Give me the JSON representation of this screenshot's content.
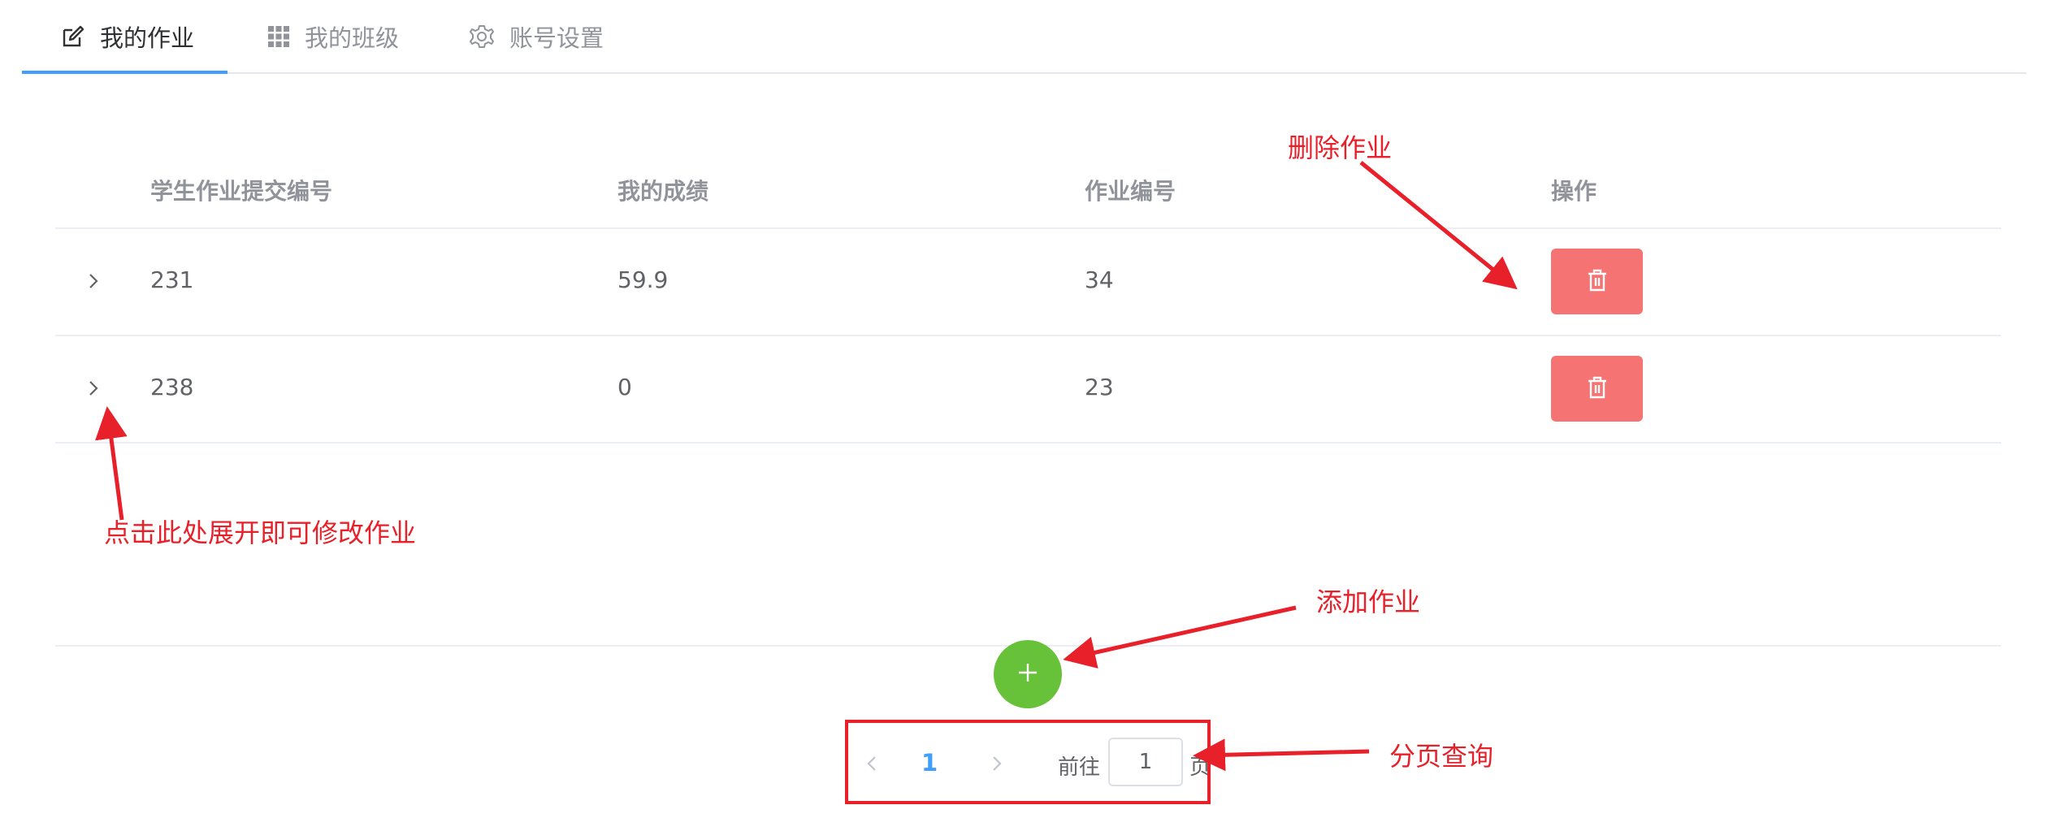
{
  "tabs": [
    {
      "label": "我的作业",
      "icon": "edit-icon",
      "active": true
    },
    {
      "label": "我的班级",
      "icon": "grid-icon",
      "active": false
    },
    {
      "label": "账号设置",
      "icon": "gear-icon",
      "active": false
    }
  ],
  "table": {
    "headers": [
      "学生作业提交编号",
      "我的成绩",
      "作业编号",
      "操作"
    ],
    "rows": [
      {
        "submission_id": "231",
        "score": "59.9",
        "assignment_id": "34"
      },
      {
        "submission_id": "238",
        "score": "0",
        "assignment_id": "23"
      }
    ]
  },
  "actions": {
    "delete_icon": "trash-icon",
    "expand_icon": "chevron-right-icon",
    "add_icon": "plus-icon"
  },
  "pagination": {
    "current_page": "1",
    "goto_label": "前往",
    "goto_value": "1",
    "page_unit": "页"
  },
  "annotations": {
    "delete": "删除作业",
    "expand": "点击此处展开即可修改作业",
    "add": "添加作业",
    "paging": "分页查询"
  },
  "colors": {
    "accent": "#409eff",
    "danger": "#f56c6c",
    "success": "#67c23a",
    "annotation": "#e8202a"
  }
}
